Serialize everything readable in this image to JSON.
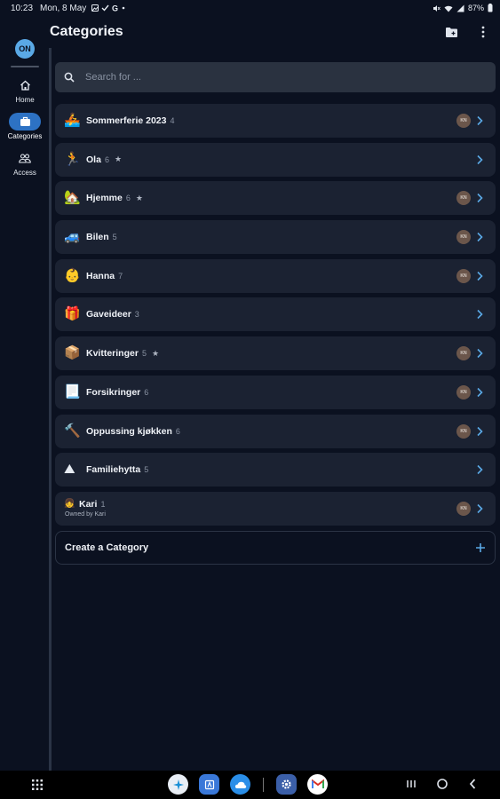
{
  "status_bar": {
    "time": "10:23",
    "date": "Mon, 8 May",
    "battery": "87%",
    "left_icons": [
      "gallery-icon",
      "check-icon",
      "google-icon",
      "dot-icon"
    ],
    "right_icons": [
      "mute-icon",
      "wifi-icon",
      "signal-icon",
      "battery-icon"
    ]
  },
  "header": {
    "title": "Categories",
    "actions": [
      "folder-icon",
      "more-vert-icon"
    ]
  },
  "nav": {
    "avatar": "ON",
    "items": [
      {
        "label": "Home",
        "icon": "home-icon",
        "active": false
      },
      {
        "label": "Categories",
        "icon": "briefcase-icon",
        "active": true
      },
      {
        "label": "Access",
        "icon": "people-icon",
        "active": false
      }
    ]
  },
  "search": {
    "placeholder": "Search for ..."
  },
  "categories": [
    {
      "emoji": "🚣",
      "name": "Sommerferie 2023",
      "count": "4",
      "star": false,
      "badge": "KN"
    },
    {
      "emoji": "🏃",
      "name": "Ola",
      "count": "6",
      "star": true,
      "badge": ""
    },
    {
      "emoji": "🏡",
      "name": "Hjemme",
      "count": "6",
      "star": true,
      "badge": "KN"
    },
    {
      "emoji": "🚙",
      "name": "Bilen",
      "count": "5",
      "star": false,
      "badge": "KN"
    },
    {
      "emoji": "👶",
      "name": "Hanna",
      "count": "7",
      "star": false,
      "badge": "KN"
    },
    {
      "emoji": "🎁",
      "name": "Gaveideer",
      "count": "3",
      "star": false,
      "badge": ""
    },
    {
      "emoji": "📦",
      "name": "Kvitteringer",
      "count": "5",
      "star": true,
      "badge": "KN"
    },
    {
      "emoji": "📃",
      "name": "Forsikringer",
      "count": "6",
      "star": false,
      "badge": "KN"
    },
    {
      "emoji": "🔨",
      "name": "Oppussing kjøkken",
      "count": "6",
      "star": false,
      "badge": "KN"
    },
    {
      "emoji": "⛰",
      "name": "Familiehytta",
      "count": "5",
      "star": false,
      "badge": ""
    }
  ],
  "shared_category": {
    "emoji": "👧",
    "name": "Kari",
    "count": "1",
    "sub": "Owned by Kari",
    "badge": "KN"
  },
  "create": {
    "label": "Create a Category",
    "icon": "plus-icon"
  },
  "taskbar": {
    "apps": [
      {
        "name": "telenor-app-icon",
        "color": "#e9eef5",
        "glyph": "✧",
        "fg": "#1a8fd6"
      },
      {
        "name": "files-app-icon",
        "color": "#3a78d8",
        "glyph": "A",
        "fg": "#ffffff"
      },
      {
        "name": "weather-app-icon",
        "color": "#2a8ee8",
        "glyph": "☁",
        "fg": "#ffffff"
      },
      {
        "name": "settings-app-icon",
        "color": "#3b5fa8",
        "glyph": "⚙",
        "fg": "#ffffff"
      },
      {
        "name": "gmail-app-icon",
        "color": "#ffffff",
        "glyph": "M",
        "fg": "#d93025"
      }
    ],
    "nav": [
      "recents-icon",
      "home-circle-icon",
      "back-icon"
    ]
  },
  "colors": {
    "background": "#0b1120",
    "row": "#1b2232",
    "accent": "#5aa9e6",
    "active_nav": "#2d72c4",
    "badge": "#6b564b"
  }
}
